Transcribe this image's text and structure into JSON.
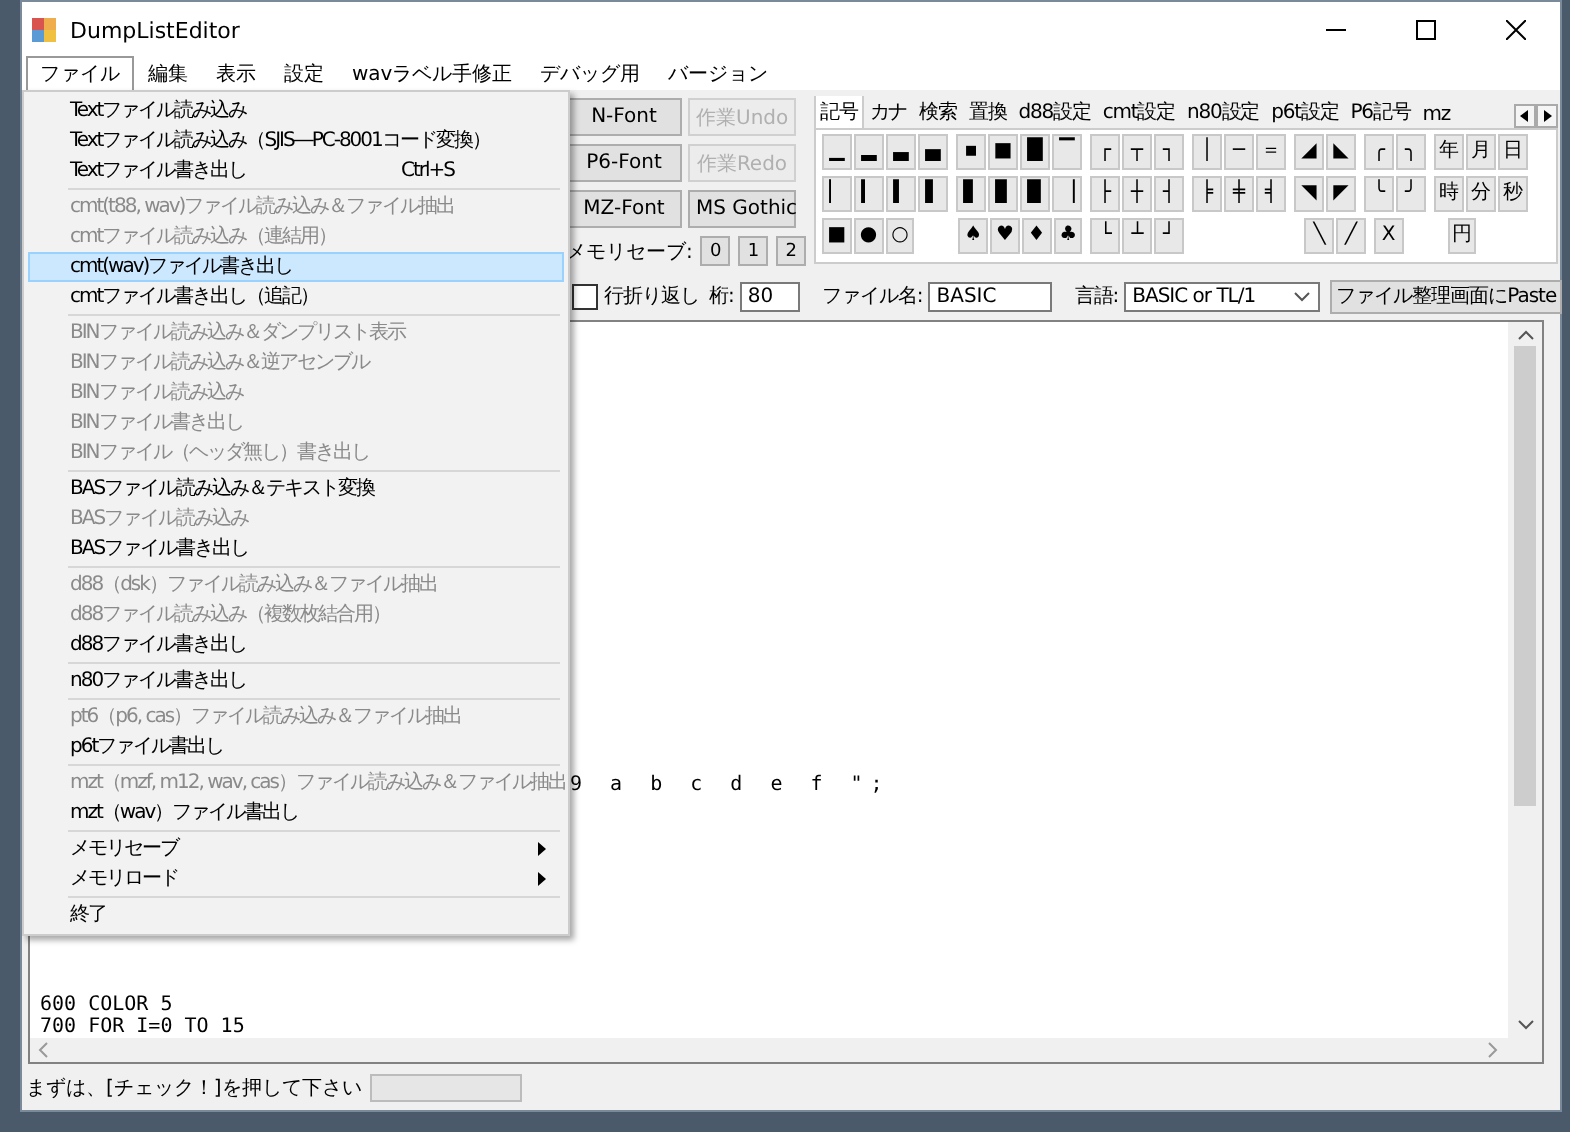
{
  "window": {
    "title": "DumpListEditor"
  },
  "menubar": [
    {
      "label": "ファイル",
      "selected": true
    },
    {
      "label": "編集",
      "selected": false
    },
    {
      "label": "表示",
      "selected": false
    },
    {
      "label": "設定",
      "selected": false
    },
    {
      "label": "wavラベル手修正",
      "selected": false
    },
    {
      "label": "デバッグ用",
      "selected": false
    },
    {
      "label": "バージョン",
      "selected": false
    }
  ],
  "file_menu": [
    {
      "kind": "item",
      "label": "Textファイル読み込み",
      "disabled": false,
      "selected": false
    },
    {
      "kind": "item",
      "label": "Textファイル読み込み（SJIS―PC-8001コード変換）",
      "disabled": false,
      "selected": false
    },
    {
      "kind": "item",
      "label": "Textファイル書き出し",
      "shortcut": "Ctrl+S",
      "disabled": false,
      "selected": false
    },
    {
      "kind": "separator"
    },
    {
      "kind": "item",
      "label": "cmt(t88, wav)ファイル読み込み＆ファイル抽出",
      "disabled": true,
      "selected": false
    },
    {
      "kind": "item",
      "label": "cmtファイル読み込み（連結用）",
      "disabled": true,
      "selected": false
    },
    {
      "kind": "item",
      "label": "cmt(wav)ファイル書き出し",
      "disabled": false,
      "selected": true
    },
    {
      "kind": "item",
      "label": "cmtファイル書き出し（追記）",
      "disabled": false,
      "selected": false
    },
    {
      "kind": "separator"
    },
    {
      "kind": "item",
      "label": "BINファイル読み込み＆ダンプリスト表示",
      "disabled": true,
      "selected": false
    },
    {
      "kind": "item",
      "label": "BINファイル読み込み＆逆アセンブル",
      "disabled": true,
      "selected": false
    },
    {
      "kind": "item",
      "label": "BINファイル読み込み",
      "disabled": true,
      "selected": false
    },
    {
      "kind": "item",
      "label": "BINファイル書き出し",
      "disabled": true,
      "selected": false
    },
    {
      "kind": "item",
      "label": "BINファイル（ヘッダ無し）書き出し",
      "disabled": true,
      "selected": false
    },
    {
      "kind": "separator"
    },
    {
      "kind": "item",
      "label": "BASファイル読み込み＆テキスト変換",
      "disabled": false,
      "selected": false
    },
    {
      "kind": "item",
      "label": "BASファイル読み込み",
      "disabled": true,
      "selected": false
    },
    {
      "kind": "item",
      "label": "BASファイル書き出し",
      "disabled": false,
      "selected": false
    },
    {
      "kind": "separator"
    },
    {
      "kind": "item",
      "label": "d88（dsk）ファイル読み込み＆ファイル抽出",
      "disabled": true,
      "selected": false
    },
    {
      "kind": "item",
      "label": "d88ファイル読み込み（複数枚結合用）",
      "disabled": true,
      "selected": false
    },
    {
      "kind": "item",
      "label": "d88ファイル書き出し",
      "disabled": false,
      "selected": false
    },
    {
      "kind": "separator"
    },
    {
      "kind": "item",
      "label": "n80ファイル書き出し",
      "disabled": false,
      "selected": false
    },
    {
      "kind": "separator"
    },
    {
      "kind": "item",
      "label": "pt6（p6, cas）ファイル読み込み＆ファイル抽出",
      "disabled": true,
      "selected": false
    },
    {
      "kind": "item",
      "label": "p6tファイル書出し",
      "disabled": false,
      "selected": false
    },
    {
      "kind": "separator"
    },
    {
      "kind": "item",
      "label": "mzt（mzf, m12, wav, cas）ファイル読み込み＆ファイル抽出",
      "disabled": true,
      "selected": false
    },
    {
      "kind": "item",
      "label": "mzt（wav）ファイル書出し",
      "disabled": false,
      "selected": false
    },
    {
      "kind": "separator"
    },
    {
      "kind": "submenu",
      "label": "メモリセーブ",
      "disabled": false,
      "selected": false
    },
    {
      "kind": "submenu",
      "label": "メモリロード",
      "disabled": false,
      "selected": false
    },
    {
      "kind": "separator"
    },
    {
      "kind": "item",
      "label": "終了",
      "disabled": false,
      "selected": false
    }
  ],
  "font_buttons": [
    {
      "label": "N-Font",
      "disabled": false
    },
    {
      "label": "作業Undo",
      "disabled": true
    },
    {
      "label": "P6-Font",
      "disabled": false
    },
    {
      "label": "作業Redo",
      "disabled": true
    },
    {
      "label": "MZ-Font",
      "disabled": false
    },
    {
      "label": "MS Gothic",
      "disabled": false
    }
  ],
  "memory_save": {
    "label": "メモリセーブ:",
    "slots": [
      "0",
      "1",
      "2"
    ]
  },
  "tabs": [
    {
      "label": "記号",
      "selected": true
    },
    {
      "label": "カナ",
      "selected": false
    },
    {
      "label": "検索",
      "selected": false
    },
    {
      "label": "置換",
      "selected": false
    },
    {
      "label": "d88設定",
      "selected": false
    },
    {
      "label": "cmt設定",
      "selected": false
    },
    {
      "label": "n80設定",
      "selected": false
    },
    {
      "label": "p6t設定",
      "selected": false
    },
    {
      "label": "P6記号",
      "selected": false
    },
    {
      "label": "mz",
      "selected": false
    }
  ],
  "symbol_rows": [
    [
      {
        "kind": "key",
        "symbol": "▁"
      },
      {
        "kind": "key",
        "symbol": "▂"
      },
      {
        "kind": "key",
        "symbol": "▃"
      },
      {
        "kind": "key",
        "symbol": "▄"
      },
      {
        "kind": "key",
        "symbol": "▪"
      },
      {
        "kind": "key",
        "symbol": "■"
      },
      {
        "kind": "key",
        "symbol": "█"
      },
      {
        "kind": "key",
        "symbol": "▔"
      },
      {
        "kind": "key",
        "symbol": "┌"
      },
      {
        "kind": "key",
        "symbol": "┬"
      },
      {
        "kind": "key",
        "symbol": "┐"
      },
      {
        "kind": "key",
        "symbol": "│"
      },
      {
        "kind": "key",
        "symbol": "─"
      },
      {
        "kind": "key",
        "symbol": "＝"
      },
      {
        "kind": "key",
        "symbol": "◢"
      },
      {
        "kind": "key",
        "symbol": "◣"
      },
      {
        "kind": "key",
        "symbol": "╭"
      },
      {
        "kind": "key",
        "symbol": "╮"
      },
      {
        "kind": "key",
        "symbol": "年"
      },
      {
        "kind": "key",
        "symbol": "月"
      },
      {
        "kind": "key",
        "symbol": "日"
      }
    ],
    [
      {
        "kind": "key",
        "symbol": "▏"
      },
      {
        "kind": "key",
        "symbol": "▎"
      },
      {
        "kind": "key",
        "symbol": "▍"
      },
      {
        "kind": "key",
        "symbol": "▌"
      },
      {
        "kind": "key",
        "symbol": "▋"
      },
      {
        "kind": "key",
        "symbol": "▊"
      },
      {
        "kind": "key",
        "symbol": "▉"
      },
      {
        "kind": "key",
        "symbol": "▕"
      },
      {
        "kind": "key",
        "symbol": "├"
      },
      {
        "kind": "key",
        "symbol": "┼"
      },
      {
        "kind": "key",
        "symbol": "┤"
      },
      {
        "kind": "key",
        "symbol": "╞"
      },
      {
        "kind": "key",
        "symbol": "╪"
      },
      {
        "kind": "key",
        "symbol": "╡"
      },
      {
        "kind": "key",
        "symbol": "◥"
      },
      {
        "kind": "key",
        "symbol": "◤"
      },
      {
        "kind": "key",
        "symbol": "╰"
      },
      {
        "kind": "key",
        "symbol": "╯"
      },
      {
        "kind": "key",
        "symbol": "時"
      },
      {
        "kind": "key",
        "symbol": "分"
      },
      {
        "kind": "key",
        "symbol": "秒"
      }
    ],
    [
      {
        "kind": "key",
        "symbol": "■"
      },
      {
        "kind": "key",
        "symbol": "●"
      },
      {
        "kind": "key",
        "symbol": "○"
      },
      {
        "kind": "gap"
      },
      {
        "kind": "key",
        "symbol": "♠"
      },
      {
        "kind": "key",
        "symbol": "♥"
      },
      {
        "kind": "key",
        "symbol": "♦"
      },
      {
        "kind": "key",
        "symbol": "♣"
      },
      {
        "kind": "key",
        "symbol": "└"
      },
      {
        "kind": "key",
        "symbol": "┴"
      },
      {
        "kind": "key",
        "symbol": "┘"
      },
      {
        "kind": "gap"
      },
      {
        "kind": "gap"
      },
      {
        "kind": "gap"
      },
      {
        "kind": "key",
        "symbol": "╲"
      },
      {
        "kind": "key",
        "symbol": "╱"
      },
      {
        "kind": "key",
        "symbol": "X"
      },
      {
        "kind": "gap"
      },
      {
        "kind": "key",
        "symbol": "円"
      },
      {
        "kind": "gap"
      },
      {
        "kind": "gap"
      }
    ]
  ],
  "options": {
    "wrap": {
      "label": "行折り返し",
      "checked": false
    },
    "columns": {
      "label": "桁:",
      "value": "80"
    },
    "filename": {
      "label": "ファイル名:",
      "value": "BASIC"
    },
    "language": {
      "label": "言語:",
      "value": "BASIC or TL/1"
    },
    "paste_button": "ファイル整理画面にPaste"
  },
  "editor": {
    "lines": [
      {
        "kind": "fragment",
        "text": "9 a b c d e f \";"
      },
      {
        "kind": "bottom",
        "text": "600 COLOR 5"
      },
      {
        "kind": "bottom",
        "text": "700 FOR I=0 TO 15"
      }
    ]
  },
  "status_bar": {
    "text": "まずは、[チェック！]を押して下さい",
    "progress": {
      "level": 0
    }
  }
}
